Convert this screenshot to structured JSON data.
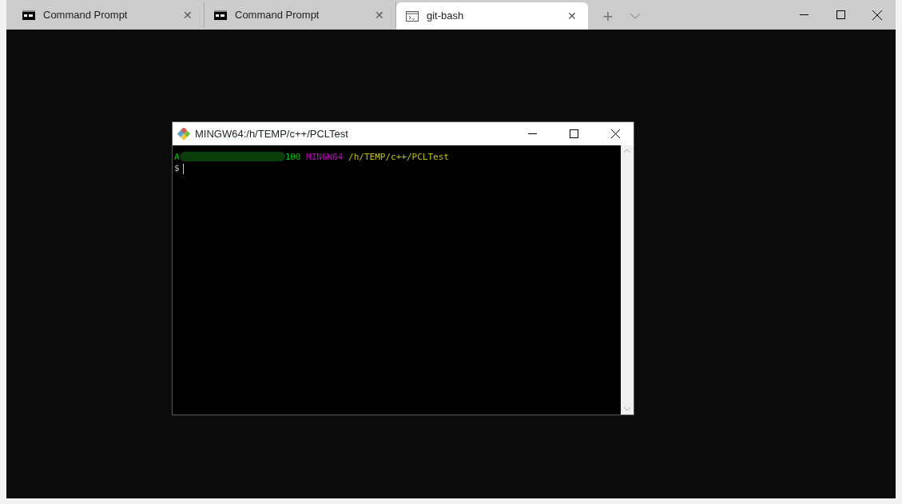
{
  "tabs": [
    {
      "title": "Command Prompt",
      "kind": "cmd",
      "selected": false,
      "close": "✕"
    },
    {
      "title": "Command Prompt",
      "kind": "cmd",
      "selected": false,
      "close": "✕"
    },
    {
      "title": "git-bash",
      "kind": "outline",
      "selected": true,
      "close": "✕"
    }
  ],
  "new_tab": "+",
  "mintty": {
    "title": "MINGW64:/h/TEMP/c++/PCLTest",
    "prompt": [
      {
        "text": "A",
        "color": "#00c000",
        "kind": "text"
      },
      {
        "kind": "redacted"
      },
      {
        "text": "100",
        "color": "#00c000",
        "kind": "text"
      },
      {
        "text": "MINGW64",
        "color": "#c000c0",
        "kind": "text"
      },
      {
        "text": "/h/TEMP/c++/PCLTest",
        "color": "#c0c000",
        "kind": "text"
      }
    ],
    "input_prompt": "$"
  }
}
